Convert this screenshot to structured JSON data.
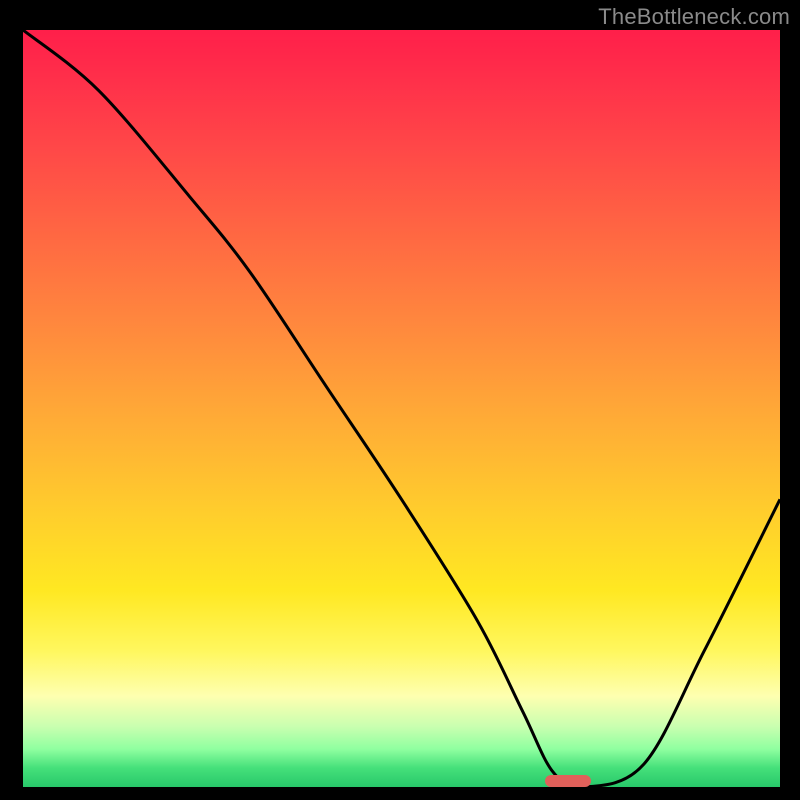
{
  "watermark": "TheBottleneck.com",
  "chart_data": {
    "type": "line",
    "title": "",
    "xlabel": "",
    "ylabel": "",
    "xlim": [
      0,
      100
    ],
    "ylim": [
      0,
      100
    ],
    "grid": false,
    "gradient_stops": [
      {
        "pos": 0,
        "color": "#ff1f4a"
      },
      {
        "pos": 0.5,
        "color": "#ffad36"
      },
      {
        "pos": 0.82,
        "color": "#fff75e"
      },
      {
        "pos": 1.0,
        "color": "#28c86a"
      }
    ],
    "series": [
      {
        "name": "bottleneck-curve",
        "color": "#000000",
        "x": [
          0,
          10,
          22,
          30,
          40,
          50,
          60,
          66,
          70,
          74,
          82,
          90,
          100
        ],
        "y": [
          100,
          92,
          78,
          68,
          53,
          38,
          22,
          10,
          2,
          0,
          3,
          18,
          38
        ]
      }
    ],
    "marker": {
      "x_center": 72,
      "width_pct": 6,
      "color": "#e0605a"
    }
  }
}
